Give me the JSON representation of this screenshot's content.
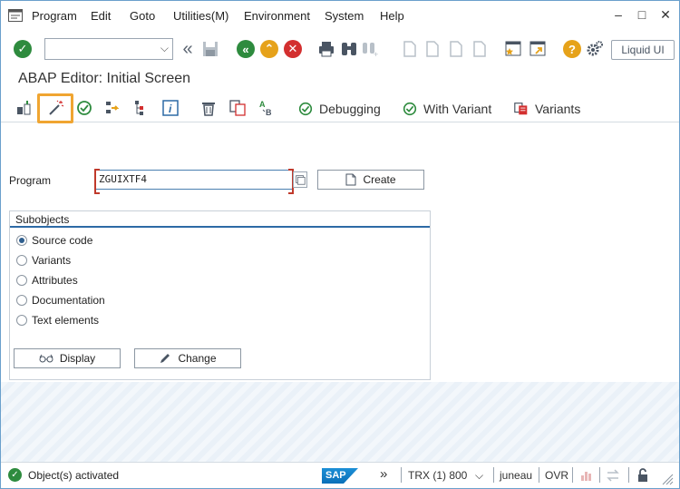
{
  "menubar": {
    "items": [
      {
        "label": "Program"
      },
      {
        "label": "Edit"
      },
      {
        "label": "Goto"
      },
      {
        "label": "Utilities(M)"
      },
      {
        "label": "Environment"
      },
      {
        "label": "System"
      },
      {
        "label": "Help"
      }
    ]
  },
  "toolbar": {
    "command_field_value": "",
    "liquid_ui_label": "Liquid UI"
  },
  "page": {
    "title": "ABAP Editor: Initial Screen"
  },
  "app_toolbar": {
    "debugging_label": "Debugging",
    "with_variant_label": "With Variant",
    "variants_label": "Variants"
  },
  "form": {
    "program_label": "Program",
    "program_value": "ZGUIXTF4",
    "create_label": "Create"
  },
  "subobjects": {
    "title": "Subobjects",
    "options": [
      {
        "label": "Source code",
        "selected": true
      },
      {
        "label": "Variants",
        "selected": false
      },
      {
        "label": "Attributes",
        "selected": false
      },
      {
        "label": "Documentation",
        "selected": false
      },
      {
        "label": "Text elements",
        "selected": false
      }
    ],
    "display_label": "Display",
    "change_label": "Change"
  },
  "statusbar": {
    "message": "Object(s) activated",
    "logo_text": "SAP",
    "system_info": "TRX (1) 800",
    "server": "juneau",
    "mode": "OVR"
  },
  "colors": {
    "highlight": "#f0a531",
    "success_green": "#2e8b3e",
    "cancel_red": "#d32f2f",
    "accent_blue": "#2d6aa5"
  }
}
